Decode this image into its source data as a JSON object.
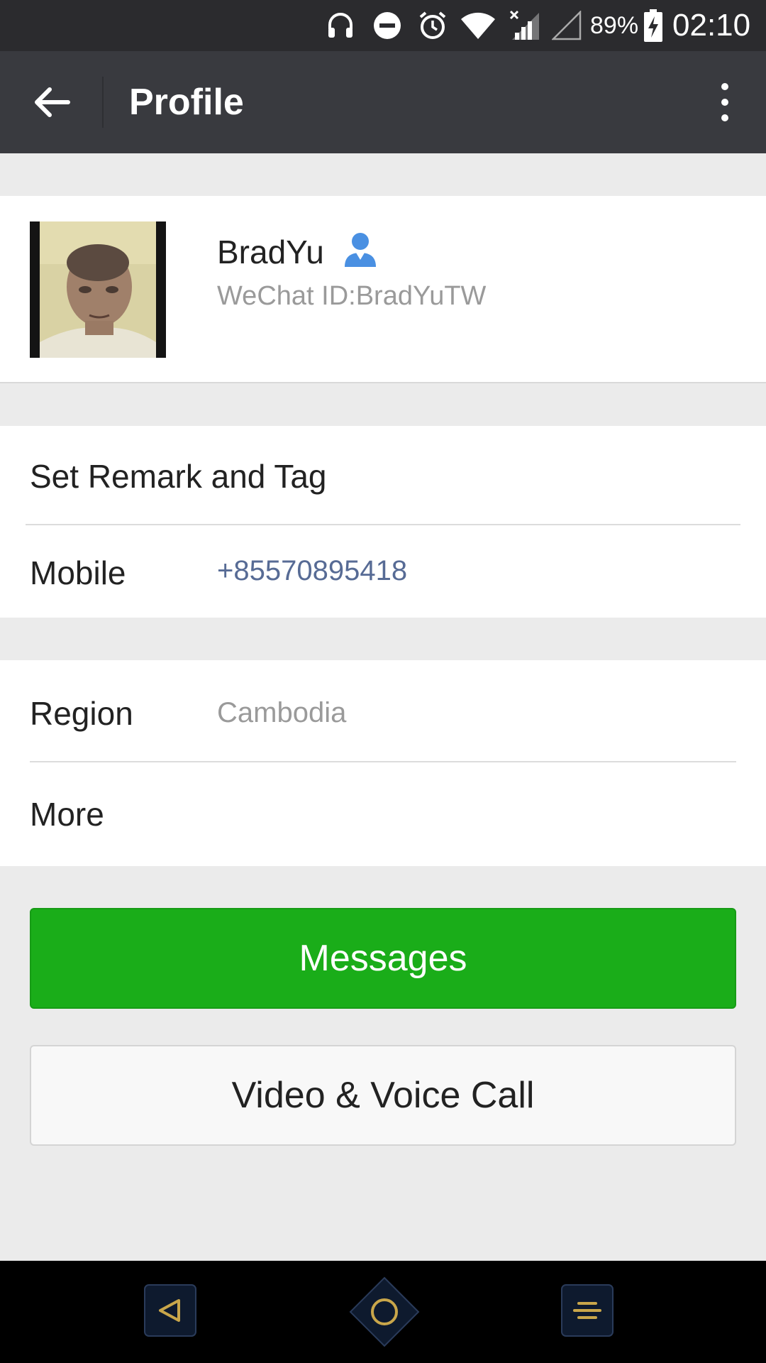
{
  "status_bar": {
    "battery": "89%",
    "time": "02:10",
    "icons": [
      "headphones-icon",
      "do-not-disturb-icon",
      "alarm-icon",
      "wifi-icon",
      "mobile-signal-icon",
      "sim-signal-icon",
      "battery-charging-icon"
    ]
  },
  "app_bar": {
    "title": "Profile",
    "back_icon": "arrow-left-icon",
    "menu_icon": "more-vertical-icon"
  },
  "profile": {
    "name": "BradYu",
    "wechat_id": "WeChat ID:BradYuTW",
    "contact_icon": "contact-person-icon",
    "avatar": "profile-photo"
  },
  "rows": {
    "remark": {
      "label": "Set Remark and Tag"
    },
    "mobile": {
      "label": "Mobile",
      "value": "+85570895418"
    },
    "region": {
      "label": "Region",
      "value": "Cambodia"
    },
    "more": {
      "label": "More"
    }
  },
  "buttons": {
    "messages": "Messages",
    "call": "Video & Voice Call"
  },
  "colors": {
    "accent_green": "#1aad19",
    "link_blue": "#576b95",
    "app_bar": "#393a3f",
    "nav_accent": "#c9a64a"
  },
  "navigation_bar": {
    "icons": [
      "nav-back-icon",
      "nav-home-icon",
      "nav-recents-icon"
    ]
  }
}
